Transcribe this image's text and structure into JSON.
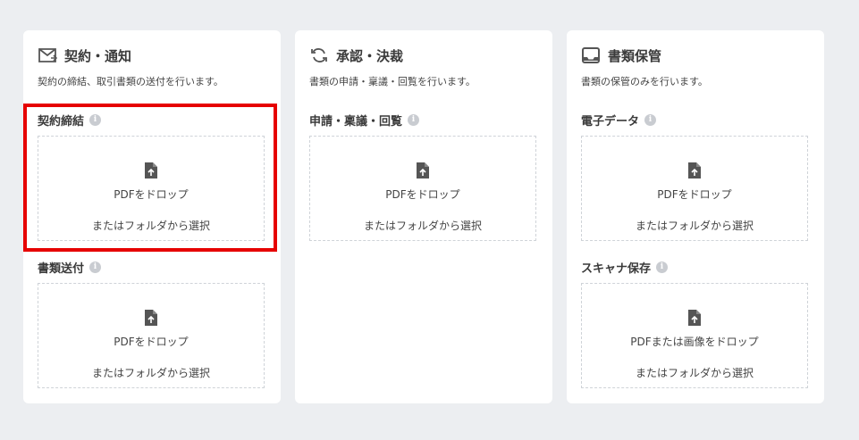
{
  "file_icon": "file-upload-icon",
  "cards": [
    {
      "icon": "mail-icon",
      "title": "契約・通知",
      "description": "契約の締結、取引書類の送付を行います。",
      "sections": [
        {
          "label": "契約締結",
          "drop_line1": "PDFをドロップ",
          "drop_line2": "またはフォルダから選択"
        },
        {
          "label": "書類送付",
          "drop_line1": "PDFをドロップ",
          "drop_line2": "またはフォルダから選択"
        }
      ]
    },
    {
      "icon": "refresh-icon",
      "title": "承認・決裁",
      "description": "書類の申請・稟議・回覧を行います。",
      "sections": [
        {
          "label": "申請・稟議・回覧",
          "drop_line1": "PDFをドロップ",
          "drop_line2": "またはフォルダから選択"
        }
      ]
    },
    {
      "icon": "inbox-icon",
      "title": "書類保管",
      "description": "書類の保管のみを行います。",
      "sections": [
        {
          "label": "電子データ",
          "drop_line1": "PDFをドロップ",
          "drop_line2": "またはフォルダから選択"
        },
        {
          "label": "スキャナ保存",
          "drop_line1": "PDFまたは画像をドロップ",
          "drop_line2": "またはフォルダから選択"
        }
      ]
    }
  ],
  "highlight_color": "#e60000",
  "info_icon_glyph": "i"
}
